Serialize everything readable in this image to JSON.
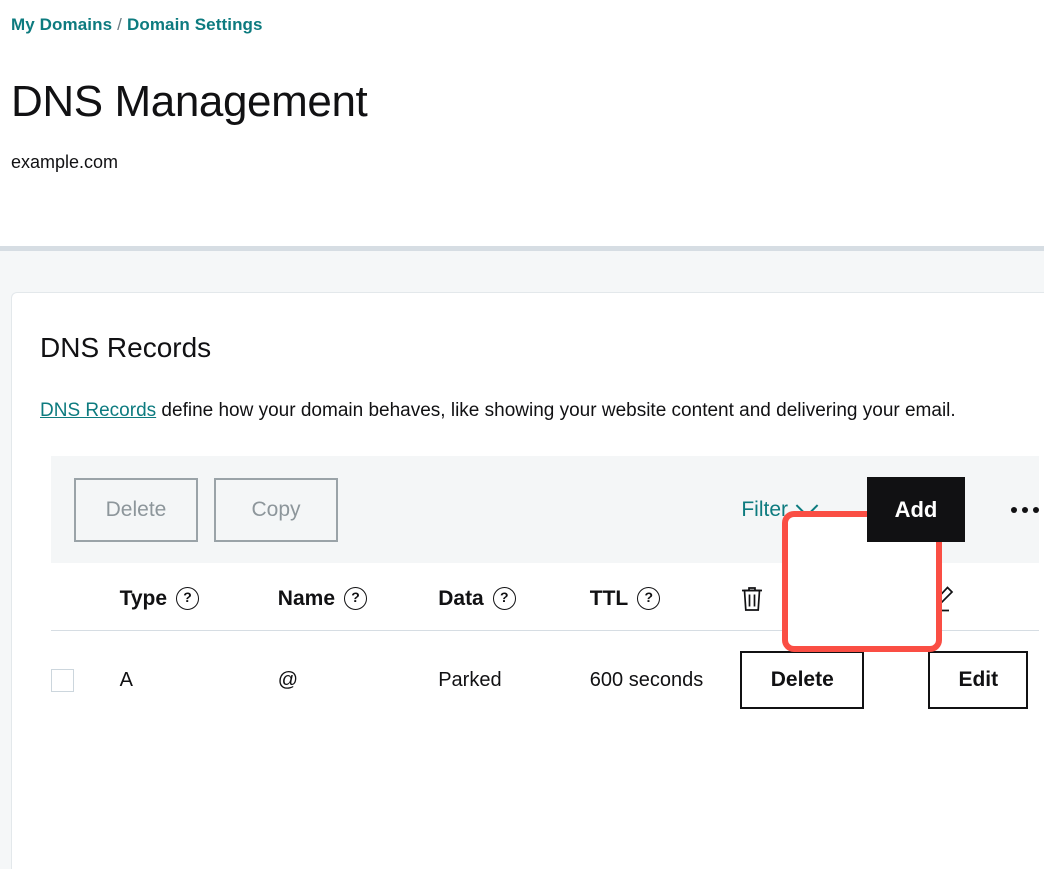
{
  "breadcrumb": {
    "items": [
      "My Domains",
      "Domain Settings"
    ],
    "separator": "/"
  },
  "header": {
    "title": "DNS Management",
    "domain": "example.com"
  },
  "card": {
    "title": "DNS Records",
    "description_link": "DNS Records",
    "description_rest": " define how your domain behaves, like showing your website content and delivering your email."
  },
  "toolbar": {
    "delete_label": "Delete",
    "copy_label": "Copy",
    "filter_label": "Filter",
    "add_label": "Add",
    "more_icon": "ellipsis-icon",
    "chevron_icon": "chevron-down-icon",
    "delete_disabled": true,
    "copy_disabled": true
  },
  "annotation": {
    "shape": "rounded-rectangle",
    "color": "#fa4e44",
    "target": "add-button"
  },
  "table": {
    "columns": [
      {
        "label": "Type",
        "help": "?"
      },
      {
        "label": "Name",
        "help": "?"
      },
      {
        "label": "Data",
        "help": "?"
      },
      {
        "label": "TTL",
        "help": "?"
      }
    ],
    "icon_columns": [
      "trash-icon",
      "pencil-icon"
    ],
    "rows": [
      {
        "selected": false,
        "type": "A",
        "name": "@",
        "data": "Parked",
        "ttl": "600 seconds",
        "delete_label": "Delete",
        "edit_label": "Edit"
      }
    ]
  },
  "colors": {
    "accent_teal": "#0d7b7f",
    "add_button_bg": "#111113",
    "highlight_red": "#fa4e44",
    "page_bg": "#f5f7f8",
    "toolbar_bg": "#f4f6f7"
  }
}
